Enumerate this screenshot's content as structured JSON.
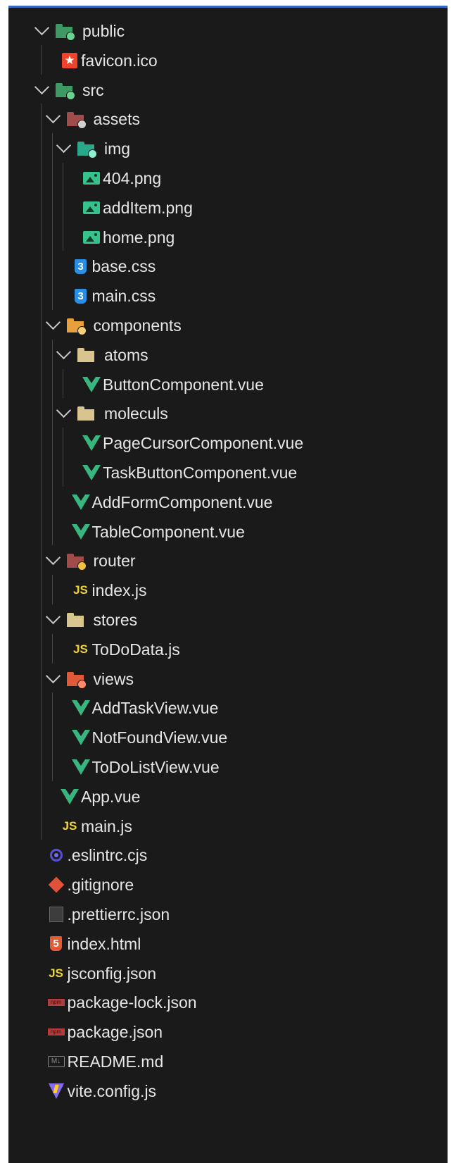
{
  "tree": {
    "items": [
      {
        "label": "public",
        "type": "folder",
        "icon": "folder-public-icon",
        "color": "#3e9a63",
        "badge": "#6ad18f",
        "depth": 0,
        "expanded": true
      },
      {
        "label": "favicon.ico",
        "type": "file",
        "icon": "favicon-icon",
        "depth": 1
      },
      {
        "label": "src",
        "type": "folder",
        "icon": "folder-src-icon",
        "color": "#3e9a63",
        "badge": "#6ad18f",
        "depth": 0,
        "expanded": true
      },
      {
        "label": "assets",
        "type": "folder",
        "icon": "folder-assets-icon",
        "color": "#a14b4b",
        "badge": "#d0d0d0",
        "depth": 1,
        "expanded": true
      },
      {
        "label": "img",
        "type": "folder",
        "icon": "folder-images-icon",
        "color": "#2aa88a",
        "badge": "#8ef0d0",
        "depth": 2,
        "expanded": true
      },
      {
        "label": "404.png",
        "type": "file",
        "icon": "image-icon",
        "depth": 3
      },
      {
        "label": "addItem.png",
        "type": "file",
        "icon": "image-icon",
        "depth": 3
      },
      {
        "label": "home.png",
        "type": "file",
        "icon": "image-icon",
        "depth": 3
      },
      {
        "label": "base.css",
        "type": "file",
        "icon": "css-icon",
        "depth": 2
      },
      {
        "label": "main.css",
        "type": "file",
        "icon": "css-icon",
        "depth": 2
      },
      {
        "label": "components",
        "type": "folder",
        "icon": "folder-components-icon",
        "color": "#e6a03c",
        "badge": "#f5d07a",
        "depth": 1,
        "expanded": true
      },
      {
        "label": "atoms",
        "type": "folder",
        "icon": "folder-icon",
        "color": "#d8c48f",
        "depth": 2,
        "expanded": true
      },
      {
        "label": "ButtonComponent.vue",
        "type": "file",
        "icon": "vue-icon",
        "depth": 3
      },
      {
        "label": "moleculs",
        "type": "folder",
        "icon": "folder-icon",
        "color": "#d8c48f",
        "depth": 2,
        "expanded": true
      },
      {
        "label": "PageCursorComponent.vue",
        "type": "file",
        "icon": "vue-icon",
        "depth": 3
      },
      {
        "label": "TaskButtonComponent.vue",
        "type": "file",
        "icon": "vue-icon",
        "depth": 3
      },
      {
        "label": "AddFormComponent.vue",
        "type": "file",
        "icon": "vue-icon",
        "depth": 2
      },
      {
        "label": "TableComponent.vue",
        "type": "file",
        "icon": "vue-icon",
        "depth": 2
      },
      {
        "label": "router",
        "type": "folder",
        "icon": "folder-router-icon",
        "color": "#a14b4b",
        "badge": "#f0c040",
        "depth": 1,
        "expanded": true
      },
      {
        "label": "index.js",
        "type": "file",
        "icon": "javascript-icon",
        "depth": 2
      },
      {
        "label": "stores",
        "type": "folder",
        "icon": "folder-icon",
        "color": "#d8c48f",
        "depth": 1,
        "expanded": true
      },
      {
        "label": "ToDoData.js",
        "type": "file",
        "icon": "javascript-icon",
        "depth": 2
      },
      {
        "label": "views",
        "type": "folder",
        "icon": "folder-views-icon",
        "color": "#e05a3a",
        "badge": "#ff8a6a",
        "depth": 1,
        "expanded": true
      },
      {
        "label": "AddTaskView.vue",
        "type": "file",
        "icon": "vue-icon",
        "depth": 2
      },
      {
        "label": "NotFoundView.vue",
        "type": "file",
        "icon": "vue-icon",
        "depth": 2
      },
      {
        "label": "ToDoListView.vue",
        "type": "file",
        "icon": "vue-icon",
        "depth": 2
      },
      {
        "label": "App.vue",
        "type": "file",
        "icon": "vue-icon",
        "depth": 1
      },
      {
        "label": "main.js",
        "type": "file",
        "icon": "javascript-icon",
        "depth": 1
      },
      {
        "label": ".eslintrc.cjs",
        "type": "file",
        "icon": "eslint-icon",
        "depth": 0
      },
      {
        "label": ".gitignore",
        "type": "file",
        "icon": "git-icon",
        "depth": 0
      },
      {
        "label": ".prettierrc.json",
        "type": "file",
        "icon": "prettier-icon",
        "depth": 0
      },
      {
        "label": "index.html",
        "type": "file",
        "icon": "html-icon",
        "depth": 0
      },
      {
        "label": "jsconfig.json",
        "type": "file",
        "icon": "jsconfig-icon",
        "depth": 0
      },
      {
        "label": "package-lock.json",
        "type": "file",
        "icon": "npm-icon",
        "depth": 0
      },
      {
        "label": "package.json",
        "type": "file",
        "icon": "npm-icon",
        "depth": 0
      },
      {
        "label": "README.md",
        "type": "file",
        "icon": "markdown-icon",
        "depth": 0
      },
      {
        "label": "vite.config.js",
        "type": "file",
        "icon": "vite-icon",
        "depth": 0
      }
    ]
  }
}
